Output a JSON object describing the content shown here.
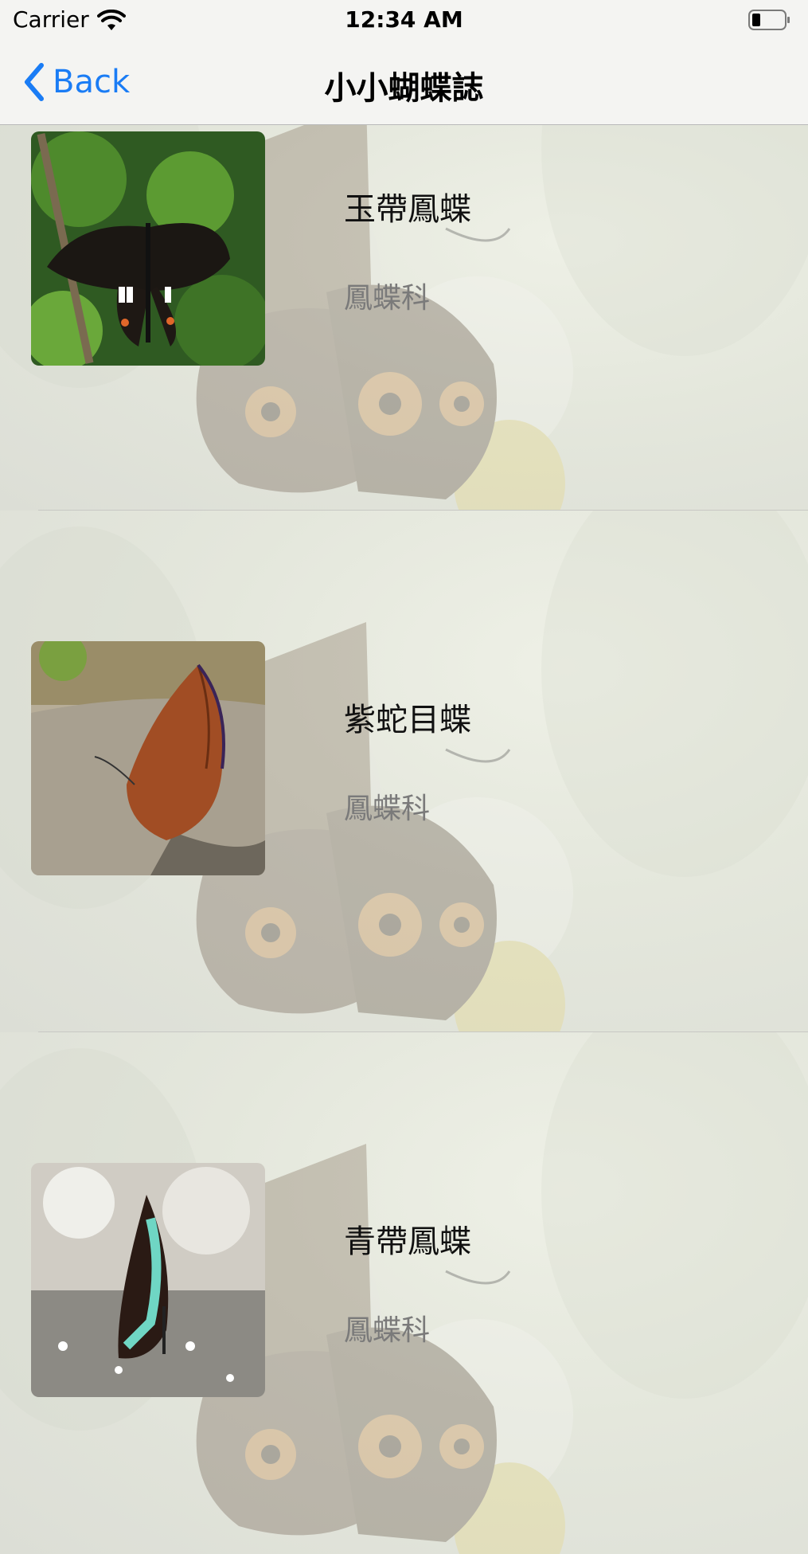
{
  "status_bar": {
    "carrier": "Carrier",
    "time": "12:34 AM"
  },
  "nav": {
    "back_label": "Back",
    "title": "小小蝴蝶誌"
  },
  "rows": [
    {
      "name": "玉帶鳳蝶",
      "family": "鳳蝶科"
    },
    {
      "name": "紫蛇目蝶",
      "family": "鳳蝶科"
    },
    {
      "name": "青帶鳳蝶",
      "family": "鳳蝶科"
    }
  ],
  "colors": {
    "accent": "#1a7cf5"
  }
}
